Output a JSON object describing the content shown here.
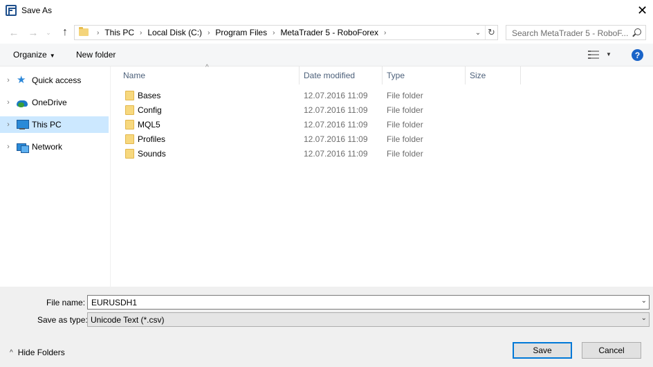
{
  "window": {
    "title": "Save As",
    "close_glyph": "✕"
  },
  "nav": {
    "back_glyph": "←",
    "forward_glyph": "→",
    "recent_glyph": "⌄",
    "up_glyph": "↑",
    "breadcrumbs": [
      "This PC",
      "Local Disk (C:)",
      "Program Files",
      "MetaTrader 5 - RoboForex"
    ],
    "separator": "›",
    "dropdown_glyph": "⌄",
    "refresh_glyph": "↻",
    "search_placeholder": "Search MetaTrader 5 - RoboF..."
  },
  "toolbar": {
    "organize_label": "Organize",
    "organize_arrow": "▼",
    "new_folder_label": "New folder",
    "view_dropdown": "▼",
    "help_label": "?"
  },
  "sidebar": {
    "items": [
      {
        "label": "Quick access",
        "icon": "quick-access-star-icon",
        "chevron": "›"
      },
      {
        "label": "OneDrive",
        "icon": "onedrive-cloud-icon",
        "chevron": "›"
      },
      {
        "label": "This PC",
        "icon": "this-pc-monitor-icon",
        "chevron": "›",
        "selected": true
      },
      {
        "label": "Network",
        "icon": "network-icon",
        "chevron": "›"
      }
    ]
  },
  "filelist": {
    "sort_caret": "^",
    "columns": [
      "Name",
      "Date modified",
      "Type",
      "Size"
    ],
    "rows": [
      {
        "name": "Bases",
        "date": "12.07.2016 11:09",
        "type": "File folder"
      },
      {
        "name": "Config",
        "date": "12.07.2016 11:09",
        "type": "File folder"
      },
      {
        "name": "MQL5",
        "date": "12.07.2016 11:09",
        "type": "File folder"
      },
      {
        "name": "Profiles",
        "date": "12.07.2016 11:09",
        "type": "File folder"
      },
      {
        "name": "Sounds",
        "date": "12.07.2016 11:09",
        "type": "File folder"
      }
    ]
  },
  "form": {
    "file_name_label": "File name:",
    "file_name_value": "EURUSDH1",
    "save_type_label": "Save as type:",
    "save_type_value": "Unicode Text (*.csv)",
    "dropdown_glyph": "⌄"
  },
  "footer": {
    "hide_folders_label": "Hide Folders",
    "hide_folders_chevron": "^",
    "save_label": "Save",
    "cancel_label": "Cancel"
  },
  "colors": {
    "accent": "#0078d7",
    "selection": "#cce8ff",
    "folder": "#f7d87e",
    "header_text": "#4c607a"
  }
}
